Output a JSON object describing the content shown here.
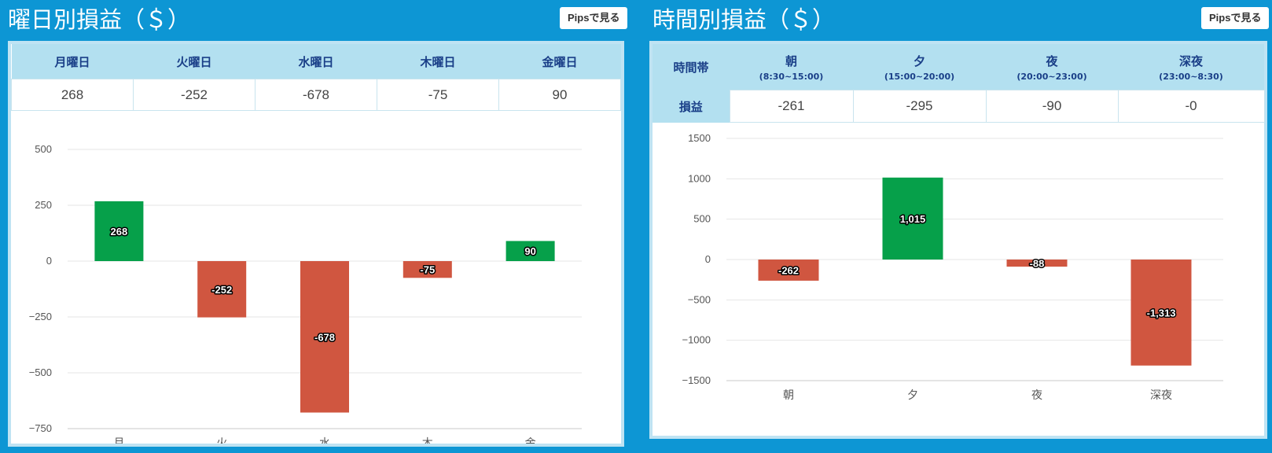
{
  "day_panel": {
    "title": "曜日別損益（＄）",
    "pips_button": "Pipsで見る",
    "table": {
      "headers": [
        "月曜日",
        "火曜日",
        "水曜日",
        "木曜日",
        "金曜日"
      ],
      "values": [
        "268",
        "-252",
        "-678",
        "-75",
        "90"
      ]
    }
  },
  "time_panel": {
    "title": "時間別損益（＄）",
    "pips_button": "Pipsで見る",
    "table": {
      "row_header_1": "時間帯",
      "row_header_2": "損益",
      "headers": [
        {
          "name": "朝",
          "range": "(8:30~15:00)"
        },
        {
          "name": "夕",
          "range": "(15:00~20:00)"
        },
        {
          "name": "夜",
          "range": "(20:00~23:00)"
        },
        {
          "name": "深夜",
          "range": "(23:00~8:30)"
        }
      ],
      "values": [
        "-261",
        "-295",
        "-90",
        "-0"
      ]
    }
  },
  "colors": {
    "background": "#0d96d4",
    "positive": "#06a04a",
    "negative": "#d05640",
    "header": "#b3e0f0",
    "header_text": "#1a3f88"
  },
  "chart_data": [
    {
      "type": "bar",
      "categories": [
        "月",
        "火",
        "水",
        "木",
        "金"
      ],
      "values": [
        268,
        -252,
        -678,
        -75,
        90
      ],
      "data_labels": [
        "268",
        "-252",
        "-678",
        "-75",
        "90"
      ],
      "ylim": [
        -750,
        500
      ],
      "yticks": [
        500,
        250,
        0,
        -250,
        -500,
        -750
      ],
      "ytick_labels": [
        "500",
        "250",
        "0",
        "−250",
        "−500",
        "−750"
      ],
      "grid": true,
      "legend": "none"
    },
    {
      "type": "bar",
      "categories": [
        "朝",
        "夕",
        "夜",
        "深夜"
      ],
      "values": [
        -262,
        1015,
        -88,
        -1313
      ],
      "data_labels": [
        "-262",
        "1,015",
        "-88",
        "-1,313"
      ],
      "ylim": [
        -1500,
        1500
      ],
      "yticks": [
        1500,
        1000,
        500,
        0,
        -500,
        -1000,
        -1500
      ],
      "ytick_labels": [
        "1500",
        "1000",
        "500",
        "0",
        "−500",
        "−1000",
        "−1500"
      ],
      "grid": true,
      "legend": "none"
    }
  ]
}
